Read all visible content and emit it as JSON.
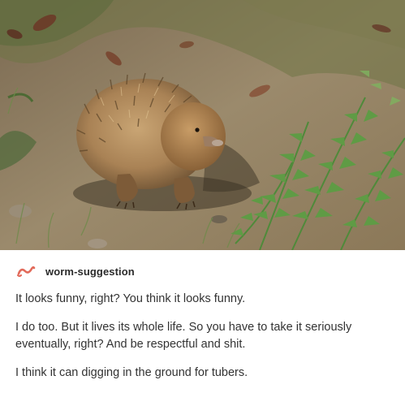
{
  "post": {
    "image": {
      "subject": "echidna-photo"
    },
    "author": {
      "username": "worm-suggestion",
      "avatar_icon": "worm-icon",
      "avatar_color": "#e26a5a"
    },
    "paragraphs": [
      "It looks funny, right? You think it looks funny.",
      "I do too. But it lives its whole life. So you have to take it seriously eventually, right? And be respectful and shit.",
      "I think it can digging in the ground for tubers."
    ]
  }
}
